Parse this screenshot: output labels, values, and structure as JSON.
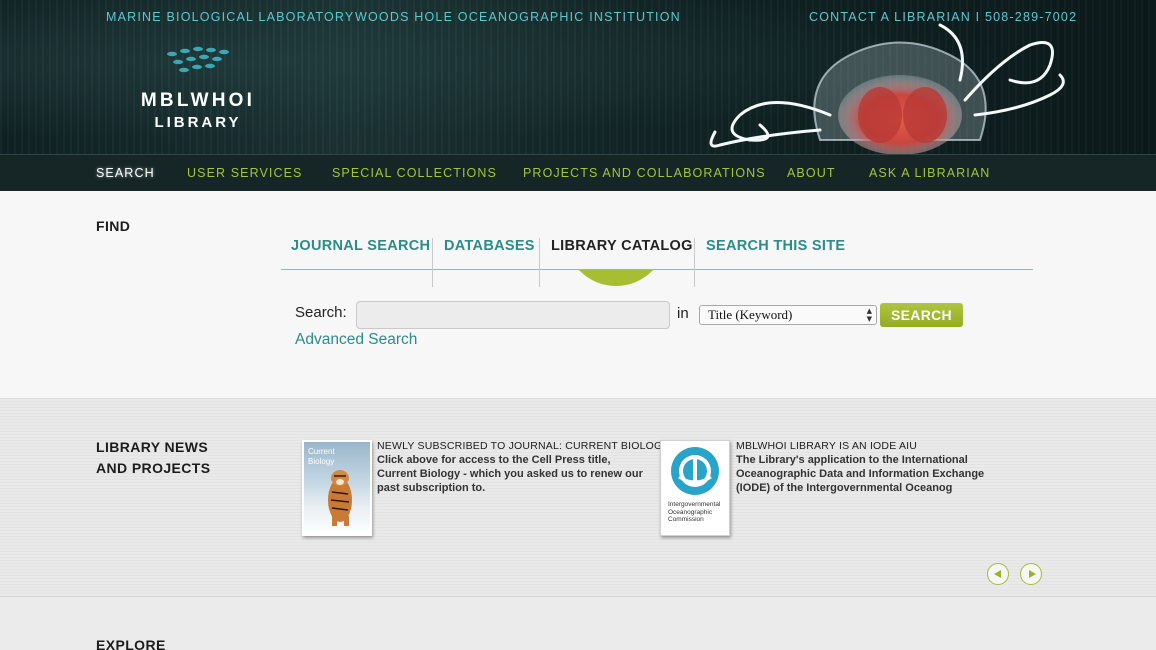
{
  "header": {
    "top_links": [
      {
        "label": "MARINE BIOLOGICAL LABORATORY"
      },
      {
        "label": "WOODS HOLE OCEANOGRAPHIC INSTITUTION"
      },
      {
        "label": "CONTACT A LIBRARIAN I 508-289-7002"
      }
    ],
    "logo": {
      "line1": "MBLWHOI",
      "line2": "LIBRARY",
      "icon": "fish-school-icon"
    },
    "hero_image": "jellyfish-illustration"
  },
  "nav": {
    "items": [
      {
        "label": "SEARCH",
        "active": true
      },
      {
        "label": "USER SERVICES"
      },
      {
        "label": "SPECIAL COLLECTIONS"
      },
      {
        "label": "PROJECTS AND COLLABORATIONS"
      },
      {
        "label": "ABOUT"
      },
      {
        "label": "ASK A LIBRARIAN"
      }
    ]
  },
  "find": {
    "title": "FIND",
    "tabs": [
      {
        "label": "JOURNAL SEARCH"
      },
      {
        "label": "DATABASES"
      },
      {
        "label": "LIBRARY CATALOG",
        "active": true
      },
      {
        "label": "SEARCH THIS SITE"
      }
    ],
    "search_label": "Search:",
    "search_value": "",
    "in_label": "in",
    "select_value": "Title (Keyword)",
    "search_button": "SEARCH",
    "advanced_link": "Advanced Search"
  },
  "news": {
    "title_line1": "LIBRARY NEWS",
    "title_line2": "AND PROJECTS",
    "items": [
      {
        "headline": "NEWLY SUBSCRIBED TO JOURNAL: CURRENT BIOLOGY",
        "body": "Click above for access to the Cell Press title, Current Biology - which you asked us to renew our past subscription to.",
        "thumb_title_line1": "Current",
        "thumb_title_line2": "Biology"
      },
      {
        "headline": "MBLWHOI LIBRARY IS AN IODE AIU",
        "body": "The Library's application to the International Oceanographic Data and Information Exchange (IODE) of the Intergovernmental Oceanog",
        "thumb_caption_line1": "Intergovernmental",
        "thumb_caption_line2": "Oceanographic",
        "thumb_caption_line3": "Commission"
      }
    ]
  },
  "explore": {
    "title": "EXPLORE"
  },
  "colors": {
    "teal": "#5ec8cf",
    "link_teal": "#2b8c8a",
    "lime": "#a4c43a",
    "dark_bg": "#162626"
  }
}
